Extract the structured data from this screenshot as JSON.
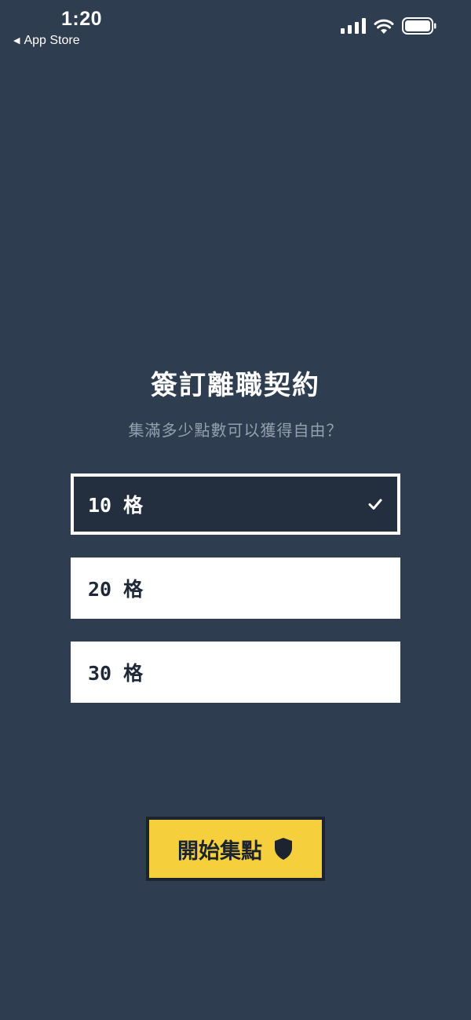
{
  "status_bar": {
    "time": "1:20",
    "back_label": "App Store",
    "icons": [
      "cellular-signal-icon",
      "wifi-icon",
      "battery-icon"
    ]
  },
  "contract": {
    "title": "簽訂離職契約",
    "subtitle": "集滿多少點數可以獲得自由？"
  },
  "options": [
    {
      "label": "10 格",
      "selected": true
    },
    {
      "label": "20 格",
      "selected": false
    },
    {
      "label": "30 格",
      "selected": false
    }
  ],
  "start_button": {
    "label": "開始集點",
    "icon": "shield-icon"
  },
  "colors": {
    "background": "#2e3d50",
    "selected_option": "#232f3e",
    "option": "#ffffff",
    "accent": "#f6d03c",
    "subtitle": "#93a0ad"
  }
}
